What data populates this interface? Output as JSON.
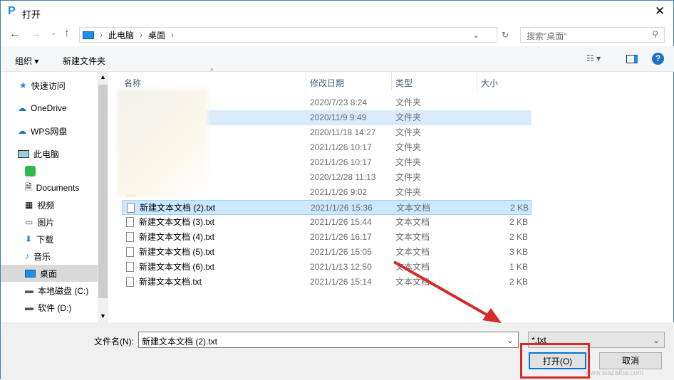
{
  "title": "打开",
  "nav": {
    "breadcrumb": [
      "此电脑",
      "桌面"
    ],
    "search_placeholder": "搜索\"桌面\""
  },
  "toolbar": {
    "organize": "组织",
    "new_folder": "新建文件夹"
  },
  "sidebar": [
    {
      "label": "快速访问"
    },
    {
      "label": "OneDrive"
    },
    {
      "label": "WPS网盘"
    },
    {
      "label": "此电脑"
    },
    {
      "label": ""
    },
    {
      "label": "Documents"
    },
    {
      "label": "视频"
    },
    {
      "label": "图片"
    },
    {
      "label": "下载"
    },
    {
      "label": "音乐"
    },
    {
      "label": "桌面"
    },
    {
      "label": "本地磁盘 (C:)"
    },
    {
      "label": "软件 (D:)"
    }
  ],
  "columns": [
    "名称",
    "修改日期",
    "类型",
    "大小"
  ],
  "rows": [
    {
      "name": "",
      "date": "2020/7/23 8:24",
      "type": "文件夹",
      "size": ""
    },
    {
      "name": "",
      "date": "2020/11/9 9:49",
      "type": "文件夹",
      "size": ""
    },
    {
      "name": "",
      "date": "2020/11/18 14:27",
      "type": "文件夹",
      "size": ""
    },
    {
      "name": "",
      "date": "2021/1/26 10:17",
      "type": "文件夹",
      "size": ""
    },
    {
      "name": "",
      "date": "2021/1/26 10:17",
      "type": "文件夹",
      "size": ""
    },
    {
      "name": "",
      "date": "2020/12/28 11:13",
      "type": "文件夹",
      "size": ""
    },
    {
      "name": "",
      "date": "2021/1/26 9:02",
      "type": "文件夹",
      "size": ""
    },
    {
      "name": "新建文本文档 (2).txt",
      "date": "2021/1/26 15:36",
      "type": "文本文档",
      "size": "2 KB"
    },
    {
      "name": "新建文本文档 (3).txt",
      "date": "2021/1/26 15:44",
      "type": "文本文档",
      "size": "2 KB"
    },
    {
      "name": "新建文本文档 (4).txt",
      "date": "2021/1/26 16:17",
      "type": "文本文档",
      "size": "2 KB"
    },
    {
      "name": "新建文本文档 (5).txt",
      "date": "2021/1/26 15:05",
      "type": "文本文档",
      "size": "3 KB"
    },
    {
      "name": "新建文本文档 (6).txt",
      "date": "2021/1/13 12:50",
      "type": "文本文档",
      "size": "1 KB"
    },
    {
      "name": "新建文本文档.txt",
      "date": "2021/1/26 15:14",
      "type": "文本文档",
      "size": "2 KB"
    }
  ],
  "footer": {
    "filename_label": "文件名(N):",
    "filename_value": "新建文本文档 (2).txt",
    "filter": "*.txt",
    "open": "打开(O)",
    "cancel": "取消"
  },
  "watermark": "www.xiazaiba.com"
}
